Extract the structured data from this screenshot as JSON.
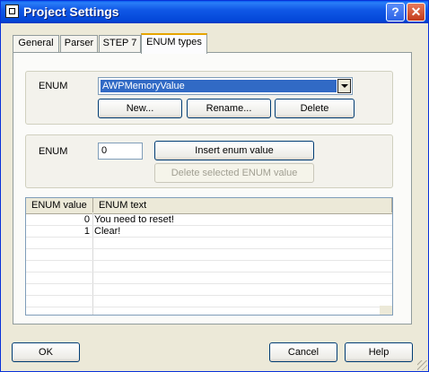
{
  "window": {
    "title": "Project Settings"
  },
  "tabs": [
    {
      "label": "General"
    },
    {
      "label": "Parser"
    },
    {
      "label": "STEP 7"
    },
    {
      "label": "ENUM types"
    }
  ],
  "enum_selector": {
    "label": "ENUM",
    "selected": "AWPMemoryValue",
    "new_label": "New...",
    "rename_label": "Rename...",
    "delete_label": "Delete"
  },
  "enum_value_editor": {
    "label": "ENUM",
    "value": "0",
    "insert_label": "Insert enum value",
    "delete_selected_label": "Delete selected ENUM value"
  },
  "table": {
    "columns": [
      "ENUM value",
      "ENUM text"
    ],
    "rows": [
      {
        "value": "0",
        "text": "You need to reset!"
      },
      {
        "value": "1",
        "text": "Clear!"
      }
    ]
  },
  "footer": {
    "ok_label": "OK",
    "cancel_label": "Cancel",
    "help_label": "Help"
  },
  "colors": {
    "titlebar": "#0a5cf0",
    "dialog_bg": "#ece9d8",
    "selection": "#316ac5",
    "close_button": "#c23a1a"
  }
}
